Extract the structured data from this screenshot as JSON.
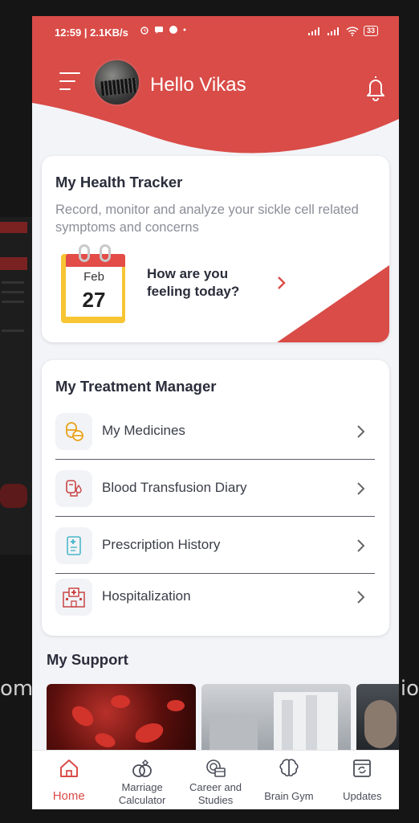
{
  "status_bar": {
    "time": "12:59",
    "speed": "2.1KB/s",
    "battery": "33"
  },
  "header": {
    "greeting": "Hello Vikas"
  },
  "health_tracker": {
    "title": "My Health Tracker",
    "description": "Record, monitor and analyze your sickle cell related symptoms and concerns",
    "calendar_month": "Feb",
    "calendar_day": "27",
    "prompt": "How are you feeling today?"
  },
  "treatment_manager": {
    "title": "My Treatment Manager",
    "items": [
      {
        "label": "My Medicines",
        "icon": "medicine-icon"
      },
      {
        "label": "Blood Transfusion Diary",
        "icon": "blood-bag-icon"
      },
      {
        "label": "Prescription History",
        "icon": "prescription-icon"
      },
      {
        "label": "Hospitalization",
        "icon": "hospital-icon"
      }
    ]
  },
  "support": {
    "title": "My Support"
  },
  "bottom_nav": {
    "items": [
      {
        "label": "Home",
        "icon": "home-icon",
        "active": true
      },
      {
        "label": "Marriage Calculator",
        "icon": "rings-icon"
      },
      {
        "label": "Career and Studies",
        "icon": "career-icon"
      },
      {
        "label": "Brain Gym",
        "icon": "brain-icon"
      },
      {
        "label": "Updates",
        "icon": "updates-icon"
      }
    ]
  },
  "colors": {
    "accent": "#d94c48",
    "calendar_yellow": "#f7c534",
    "background": "#f3f4f8"
  }
}
